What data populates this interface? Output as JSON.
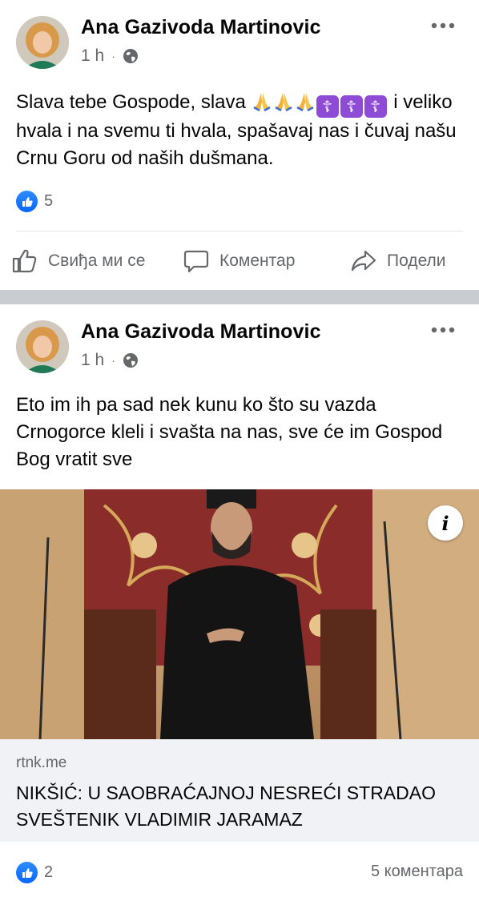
{
  "posts": [
    {
      "author": "Ana Gazivoda Martinovic",
      "time": "1 h",
      "audience_icon": "globe-icon",
      "text_part1": "Slava tebe Gospode, slava ",
      "text_part2": " i veliko hvala i na svemu ti hvala, spašavaj nas i čuvaj našu Crnu Goru od naših dušmana.",
      "emojis": [
        "folded-hands-icon",
        "folded-hands-icon",
        "folded-hands-icon",
        "orthodox-cross-icon",
        "orthodox-cross-icon",
        "orthodox-cross-icon"
      ],
      "cross_glyph": "☦",
      "reaction_count": "5",
      "actions": {
        "like": "Свиђа ми се",
        "comment": "Коментар",
        "share": "Подели"
      }
    },
    {
      "author": "Ana Gazivoda Martinovic",
      "time": "1 h",
      "audience_icon": "globe-icon",
      "text": "Eto im ih pa sad nek kunu ko što su vazda Crnogorce kleli i svašta na nas, sve će im Gospod Bog vratit sve",
      "link": {
        "domain": "rtnk.me",
        "title": "NIKŠIĆ: U SAOBRAĆAJNOJ NESREĆI STRADAO SVEŠTENIK VLADIMIR JARAMAZ",
        "info_glyph": "i"
      },
      "reaction_count": "2",
      "comments_count": "5 коментара"
    }
  ],
  "colors": {
    "text": "#050505",
    "secondary_text": "#65676b",
    "like_blue": "#0866ff",
    "separator": "#c9ccd1",
    "link_background": "#f0f2f5"
  }
}
